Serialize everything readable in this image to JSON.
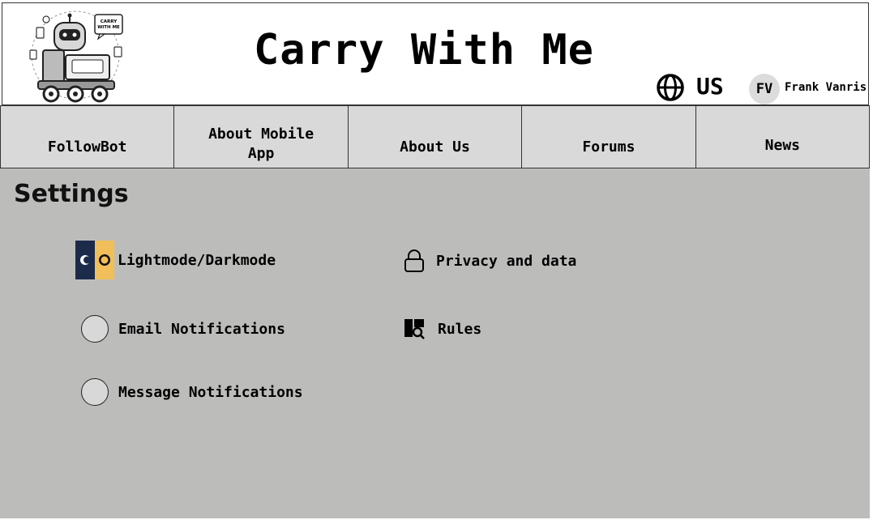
{
  "header": {
    "title": "Carry With Me",
    "logo_icon": "robot-carrier-logo",
    "logo_bubble_text": "CARRY WITH ME",
    "region": "US",
    "user_initials": "FV",
    "user_name": "Frank Vanris"
  },
  "nav": {
    "items": [
      {
        "label": "FollowBot"
      },
      {
        "label": "About Mobile App"
      },
      {
        "label": "About Us"
      },
      {
        "label": "Forums"
      },
      {
        "label": "News"
      }
    ]
  },
  "settings": {
    "title": "Settings",
    "left": [
      {
        "label": "Lightmode/Darkmode",
        "icon": "lightmode-darkmode-icon"
      },
      {
        "label": "Email Notifications",
        "icon": "toggle-circle"
      },
      {
        "label": "Message Notifications",
        "icon": "toggle-circle"
      }
    ],
    "right": [
      {
        "label": "Privacy and data",
        "icon": "lock-icon"
      },
      {
        "label": "Rules",
        "icon": "book-search-icon"
      }
    ]
  },
  "colors": {
    "content_bg": "#bcbdbb",
    "nav_bg": "#d9d9d9",
    "dark_mode": "#1c2b4a",
    "light_mode": "#f1bf5a"
  }
}
